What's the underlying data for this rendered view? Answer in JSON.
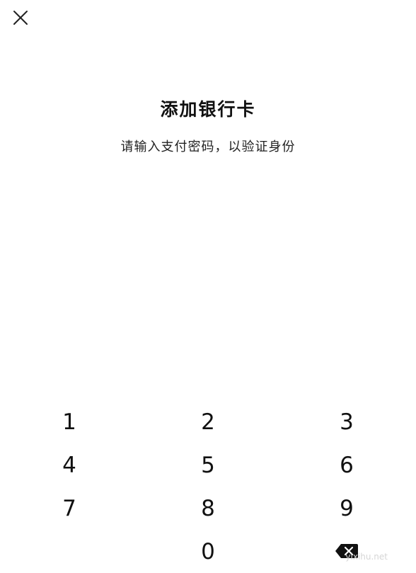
{
  "header": {
    "close_icon": "close-icon"
  },
  "main": {
    "title": "添加银行卡",
    "subtitle": "请输入支付密码，以验证身份"
  },
  "keypad": {
    "keys": [
      "1",
      "2",
      "3",
      "4",
      "5",
      "6",
      "7",
      "8",
      "9",
      "",
      "0"
    ],
    "delete_icon": "backspace-icon"
  },
  "watermark": "yixihu.net"
}
